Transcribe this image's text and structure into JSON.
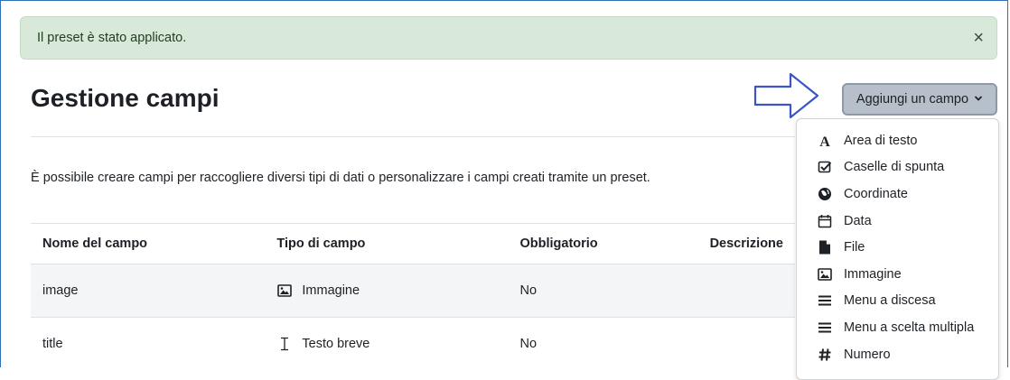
{
  "alert": {
    "message": "Il preset è stato applicato.",
    "close": "×"
  },
  "page": {
    "title": "Gestione campi",
    "description": "È possibile creare campi per raccogliere diversi tipi di dati o personalizzare i campi creati tramite un preset."
  },
  "add_button": {
    "label": "Aggiungi un campo",
    "chevron": "⌄"
  },
  "table": {
    "headers": [
      "Nome del campo",
      "Tipo di campo",
      "Obbligatorio",
      "Descrizione"
    ],
    "rows": [
      {
        "name": "image",
        "type": "Immagine",
        "type_icon": "image-icon",
        "required": "No"
      },
      {
        "name": "title",
        "type": "Testo breve",
        "type_icon": "text-cursor-icon",
        "required": "No"
      }
    ]
  },
  "menu": {
    "items": [
      {
        "label": "Area di testo",
        "icon": "font-icon"
      },
      {
        "label": "Caselle di spunta",
        "icon": "checkbox-icon"
      },
      {
        "label": "Coordinate",
        "icon": "globe-icon"
      },
      {
        "label": "Data",
        "icon": "calendar-icon"
      },
      {
        "label": "File",
        "icon": "file-icon"
      },
      {
        "label": "Immagine",
        "icon": "image-icon"
      },
      {
        "label": "Menu a discesa",
        "icon": "bars-icon"
      },
      {
        "label": "Menu a scelta multipla",
        "icon": "bars-icon"
      },
      {
        "label": "Numero",
        "icon": "hash-icon"
      }
    ]
  },
  "colors": {
    "alert_bg": "#d9e9d9",
    "button_bg": "#b7bfca",
    "arrow": "#3b55c9",
    "frame": "#2f6fb6"
  }
}
